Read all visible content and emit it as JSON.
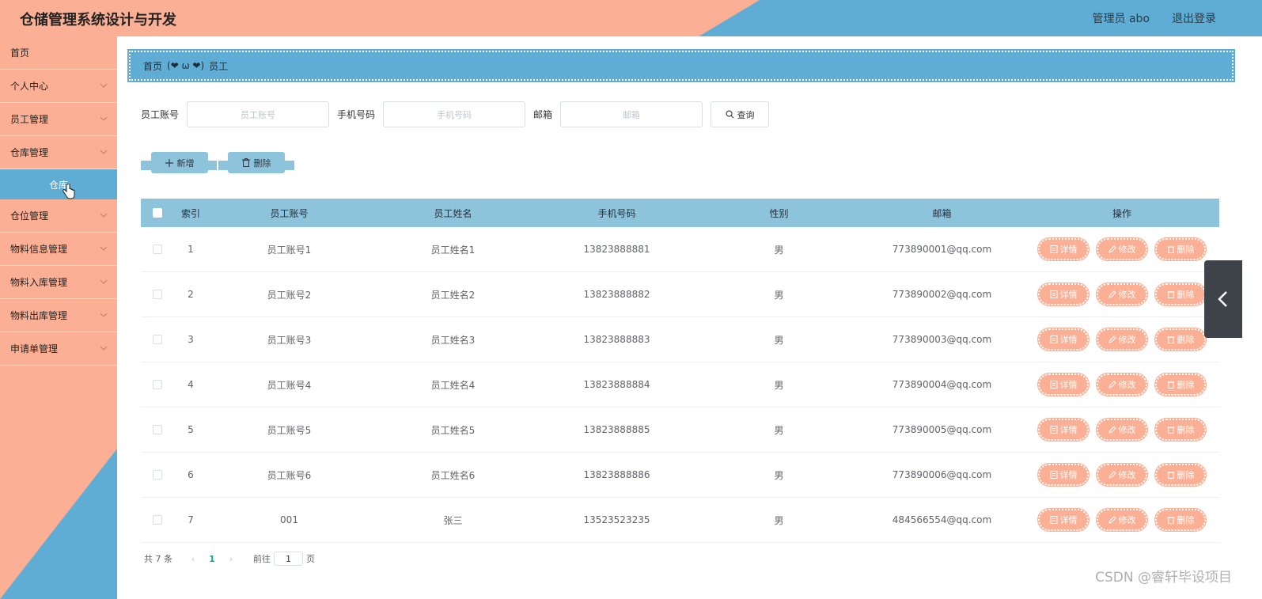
{
  "header": {
    "title": "仓储管理系统设计与开发",
    "user_label": "管理员 abo",
    "logout_label": "退出登录"
  },
  "sidebar": {
    "items": [
      {
        "label": "首页",
        "expandable": false
      },
      {
        "label": "个人中心",
        "expandable": true
      },
      {
        "label": "员工管理",
        "expandable": true
      },
      {
        "label": "仓库管理",
        "expandable": true
      },
      {
        "label": "仓库",
        "expandable": false,
        "sub": true,
        "active": true
      },
      {
        "label": "仓位管理",
        "expandable": true
      },
      {
        "label": "物料信息管理",
        "expandable": true
      },
      {
        "label": "物料入库管理",
        "expandable": true
      },
      {
        "label": "物料出库管理",
        "expandable": true
      },
      {
        "label": "申请单管理",
        "expandable": true
      }
    ]
  },
  "breadcrumb": {
    "home": "首页",
    "separator": "(❤ ω ❤)",
    "current": "员工"
  },
  "search": {
    "account_label": "员工账号",
    "account_placeholder": "员工账号",
    "phone_label": "手机号码",
    "phone_placeholder": "手机号码",
    "email_label": "邮箱",
    "email_placeholder": "邮箱",
    "query_label": "查询"
  },
  "actions": {
    "add_label": "新增",
    "delete_label": "删除"
  },
  "table": {
    "headers": [
      "索引",
      "员工账号",
      "员工姓名",
      "手机号码",
      "性别",
      "邮箱",
      "操作"
    ],
    "rows": [
      {
        "index": "1",
        "account": "员工账号1",
        "name": "员工姓名1",
        "phone": "13823888881",
        "sex": "男",
        "email": "773890001@qq.com"
      },
      {
        "index": "2",
        "account": "员工账号2",
        "name": "员工姓名2",
        "phone": "13823888882",
        "sex": "男",
        "email": "773890002@qq.com"
      },
      {
        "index": "3",
        "account": "员工账号3",
        "name": "员工姓名3",
        "phone": "13823888883",
        "sex": "男",
        "email": "773890003@qq.com"
      },
      {
        "index": "4",
        "account": "员工账号4",
        "name": "员工姓名4",
        "phone": "13823888884",
        "sex": "男",
        "email": "773890004@qq.com"
      },
      {
        "index": "5",
        "account": "员工账号5",
        "name": "员工姓名5",
        "phone": "13823888885",
        "sex": "男",
        "email": "773890005@qq.com"
      },
      {
        "index": "6",
        "account": "员工账号6",
        "name": "员工姓名6",
        "phone": "13823888886",
        "sex": "男",
        "email": "773890006@qq.com"
      },
      {
        "index": "7",
        "account": "001",
        "name": "张三",
        "phone": "13523523235",
        "sex": "男",
        "email": "484566554@qq.com"
      }
    ],
    "op_labels": {
      "detail": "详情",
      "edit": "修改",
      "delete": "删除"
    }
  },
  "pagination": {
    "total_text": "共 7 条",
    "current_page": "1",
    "goto_label": "前往",
    "goto_value": "1",
    "page_suffix": "页"
  },
  "watermark": "CSDN @睿轩毕设项目",
  "colors": {
    "salmon": "#fbb096",
    "blue": "#5fadd4",
    "light_blue": "#8ec3dc",
    "active_page": "#17a589"
  }
}
